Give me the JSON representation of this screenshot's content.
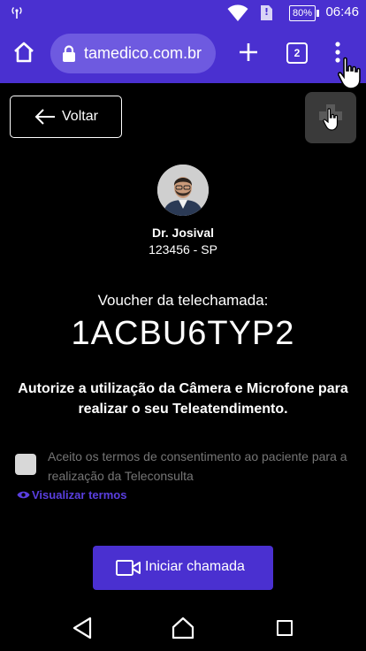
{
  "status_bar": {
    "battery": "80%",
    "time": "06:46",
    "sim_icon": "!"
  },
  "browser": {
    "url": "tamedico.com.br",
    "tab_count": "2"
  },
  "page": {
    "back_label": "Voltar",
    "doctor": {
      "name": "Dr. Josival",
      "crm": "123456 - SP"
    },
    "voucher_label": "Voucher da telechamada:",
    "voucher_code": "1ACBU6TYP2",
    "authorize_text": "Autorize a utilização da Câmera e Microfone para realizar o seu Teleatendimento.",
    "terms_text": "Aceito os termos de consentimento ao paciente para a realização da Teleconsulta",
    "view_terms_label": "Visualizar termos",
    "start_call_label": "Iniciar chamada"
  },
  "colors": {
    "accent": "#4a30d0",
    "link": "#5a3fe0",
    "background": "#000000"
  }
}
